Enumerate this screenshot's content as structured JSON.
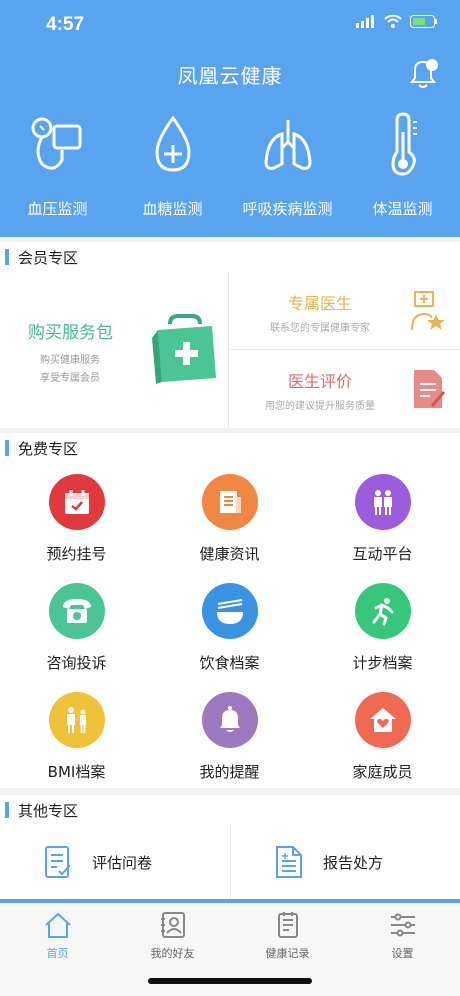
{
  "status_bar": {
    "time": "4:57"
  },
  "header": {
    "title": "凤凰云健康"
  },
  "monitors": [
    {
      "label": "血压监测",
      "icon": "blood-pressure-icon"
    },
    {
      "label": "血糖监测",
      "icon": "blood-sugar-icon"
    },
    {
      "label": "呼吸疾病监测",
      "icon": "lungs-icon"
    },
    {
      "label": "体温监测",
      "icon": "thermometer-icon"
    }
  ],
  "member_section": {
    "title": "会员专区",
    "buy": {
      "title": "购买服务包",
      "sub1": "购买健康服务",
      "sub2": "享受专属会员"
    },
    "doctor": {
      "title": "专属医生",
      "sub": "联系您的专属健康专家"
    },
    "review": {
      "title": "医生评价",
      "sub": "用您的建议提升服务质量"
    }
  },
  "free_section": {
    "title": "免费专区",
    "items": [
      {
        "label": "预约挂号",
        "icon": "calendar-icon",
        "color": "#e0393e"
      },
      {
        "label": "健康资讯",
        "icon": "news-icon",
        "color": "#f08844"
      },
      {
        "label": "互动平台",
        "icon": "people-icon",
        "color": "#9b5ddc"
      },
      {
        "label": "咨询投诉",
        "icon": "telephone-icon",
        "color": "#4cc594"
      },
      {
        "label": "饮食档案",
        "icon": "bowl-icon",
        "color": "#3a93e2"
      },
      {
        "label": "计步档案",
        "icon": "runner-icon",
        "color": "#37c77a"
      },
      {
        "label": "BMI档案",
        "icon": "bmi-icon",
        "color": "#f0c23a"
      },
      {
        "label": "我的提醒",
        "icon": "bell-icon",
        "color": "#9d79c0"
      },
      {
        "label": "家庭成员",
        "icon": "house-heart-icon",
        "color": "#ef6a52"
      }
    ]
  },
  "other_section": {
    "title": "其他专区",
    "items": [
      {
        "label": "评估问卷",
        "icon": "questionnaire-icon"
      },
      {
        "label": "报告处方",
        "icon": "report-icon"
      }
    ]
  },
  "tabbar": [
    {
      "label": "首页",
      "icon": "home-icon",
      "active": true
    },
    {
      "label": "我的好友",
      "icon": "contacts-icon",
      "active": false
    },
    {
      "label": "健康记录",
      "icon": "record-icon",
      "active": false
    },
    {
      "label": "设置",
      "icon": "settings-icon",
      "active": false
    }
  ]
}
